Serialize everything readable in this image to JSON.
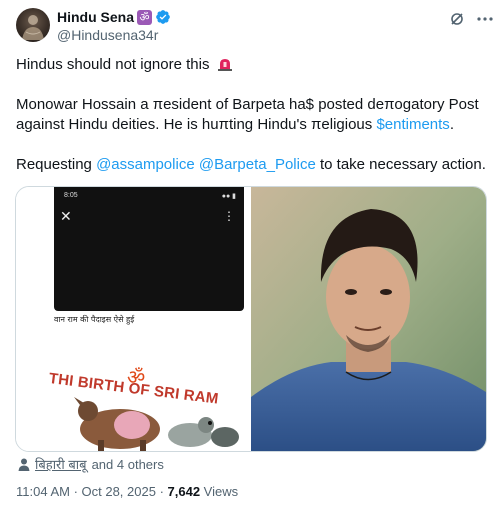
{
  "author": {
    "display_name": "Hindu Sena",
    "name_badge_glyph": "ॐ",
    "verified_icon": "verified-badge-icon",
    "handle": "@Hindusena34r"
  },
  "header_icons": [
    "grok-icon",
    "more-options-icon"
  ],
  "tweet": {
    "line1": "Hindus should not ignore this",
    "line1_emoji": "police-siren-icon",
    "paragraph2_line1": "Monowar Hossain a πesident of Barpeta ha$ posted deπogatory Post",
    "paragraph2_line2_a": "against Hindu deities. He is huπting Hindu's πeligious ",
    "paragraph2_line2_link": "$entiments",
    "paragraph2_line2_b": ".",
    "paragraph3_a": "Requesting ",
    "mention1": "@assampolice",
    "mention2": "@Barpeta_Police",
    "paragraph3_b": " to take necessary action."
  },
  "media": {
    "left_image": {
      "status_time": "8:05",
      "status_right": "●● ▮",
      "close_glyph": "✕",
      "menu_glyph": "⋮",
      "hindi_caption": "वान राम की पैदाइस ऐसे हुई",
      "image_title": "THI BIRTH OF SRI RAM",
      "om_glyph": "ॐ"
    },
    "right_image": {
      "description_icon": "portrait-photo"
    }
  },
  "liked_by": {
    "icon": "person-icon",
    "name": "बिहारी बाबू",
    "suffix": "and 4 others"
  },
  "meta": {
    "timestamp": "11:04 AM · Oct 28, 2025 · ",
    "views_count": "7,642",
    "views_label": " Views"
  },
  "colors": {
    "link": "#1d9bf0",
    "secondary_text": "#536471",
    "badge_purple": "#9b59b6",
    "verified_blue": "#1d9bf0",
    "siren_red": "#e0245e"
  }
}
